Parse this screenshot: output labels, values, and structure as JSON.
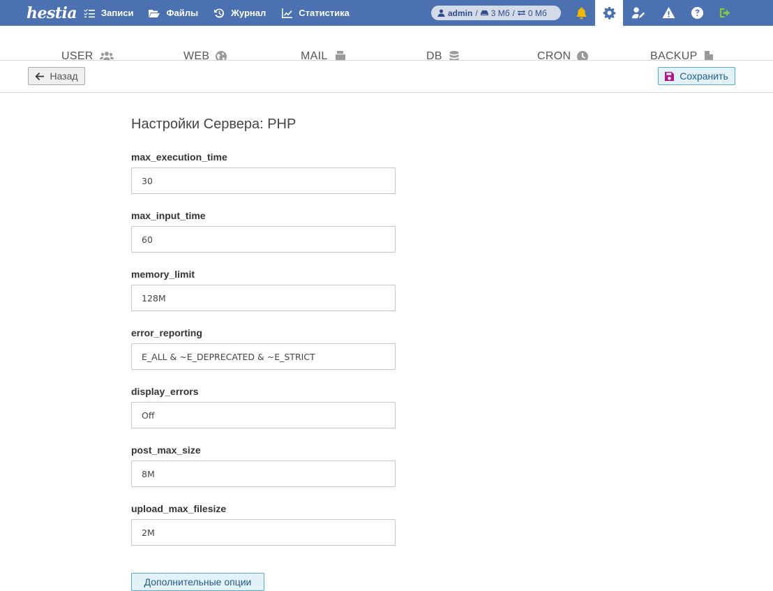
{
  "app": {
    "logo_text": "hestia"
  },
  "nav": {
    "items": [
      {
        "label": "Записи",
        "icon": "list-check-icon"
      },
      {
        "label": "Файлы",
        "icon": "folder-open-icon"
      },
      {
        "label": "Журнал",
        "icon": "history-icon"
      },
      {
        "label": "Статистика",
        "icon": "chart-line-icon"
      }
    ]
  },
  "userpill": {
    "username": "admin",
    "disk": "3 Мб",
    "bandwidth": "0 Мб",
    "sep1": "/",
    "sep2": "/"
  },
  "top_icons": [
    "bell-icon",
    "gear-icon",
    "user-pen-icon",
    "warning-icon",
    "help-icon",
    "logout-icon"
  ],
  "colors": {
    "topbar": "#4c71b0",
    "bell": "#f2b800",
    "logout": "#86c53d",
    "save_icon": "#b2128d",
    "accent_button_bg": "#e3f1f8"
  },
  "tabs": [
    {
      "label": "USER",
      "icon": "users-icon"
    },
    {
      "label": "WEB",
      "icon": "globe-icon"
    },
    {
      "label": "MAIL",
      "icon": "mail-bulk-icon"
    },
    {
      "label": "DB",
      "icon": "database-icon"
    },
    {
      "label": "CRON",
      "icon": "clock-icon"
    },
    {
      "label": "BACKUP",
      "icon": "file-icon"
    }
  ],
  "toolbar": {
    "back_label": "Назад",
    "save_label": "Сохранить"
  },
  "form": {
    "title": "Настройки Сервера: PHP",
    "fields": [
      {
        "label": "max_execution_time",
        "value": "30"
      },
      {
        "label": "max_input_time",
        "value": "60"
      },
      {
        "label": "memory_limit",
        "value": "128M"
      },
      {
        "label": "error_reporting",
        "value": "E_ALL & ~E_DEPRECATED & ~E_STRICT"
      },
      {
        "label": "display_errors",
        "value": "Off"
      },
      {
        "label": "post_max_size",
        "value": "8M"
      },
      {
        "label": "upload_max_filesize",
        "value": "2M"
      }
    ],
    "more_options_label": "Дополнительные опции"
  }
}
